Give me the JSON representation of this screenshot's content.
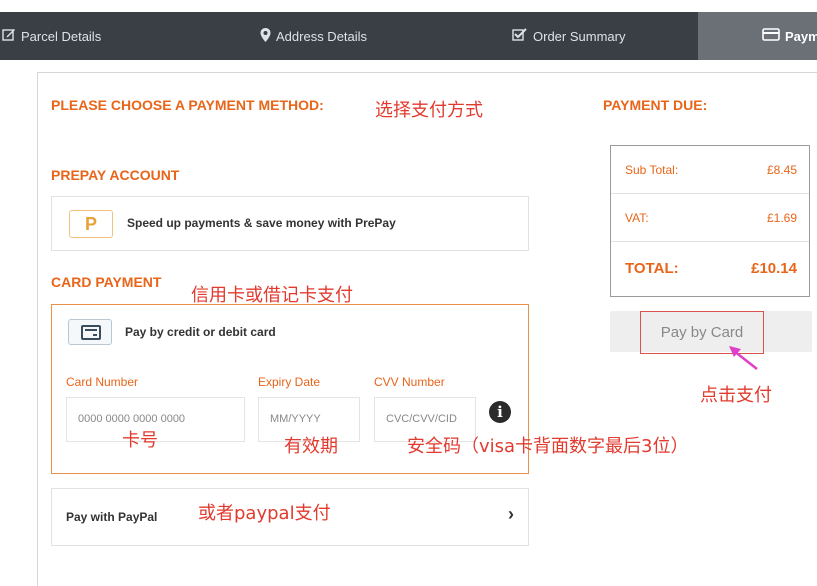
{
  "nav": {
    "steps": [
      {
        "label": "Parcel Details",
        "icon": "edit-icon"
      },
      {
        "label": "Address Details",
        "icon": "map-marker-icon"
      },
      {
        "label": "Order Summary",
        "icon": "checkbox-icon"
      },
      {
        "label": "Payment",
        "icon": "credit-card-icon"
      }
    ]
  },
  "main": {
    "choose_heading": "PLEASE CHOOSE A PAYMENT METHOD:",
    "prepay": {
      "heading": "PREPAY ACCOUNT",
      "icon_glyph": "P",
      "text": "Speed up payments & save money with PrePay"
    },
    "card": {
      "heading": "CARD PAYMENT",
      "title": "Pay by credit or debit card",
      "fields": [
        {
          "label": "Card Number",
          "placeholder": "0000 0000 0000 0000"
        },
        {
          "label": "Expiry Date",
          "placeholder": "MM/YYYY"
        },
        {
          "label": "CVV Number",
          "placeholder": "CVC/CVV/CID"
        }
      ],
      "info_glyph": "i"
    },
    "paypal": {
      "text": "Pay with PayPal",
      "chevron": "›"
    }
  },
  "summary": {
    "heading": "PAYMENT DUE:",
    "rows": [
      {
        "label": "Sub Total:",
        "value": "£8.45"
      },
      {
        "label": "VAT:",
        "value": "£1.69"
      },
      {
        "label": "TOTAL:",
        "value": "£10.14"
      }
    ],
    "button": "Pay by Card"
  },
  "annotations": {
    "choose": "选择支付方式",
    "card": "信用卡或借记卡支付",
    "card_number": "卡号",
    "expiry": "有效期",
    "cvv": "安全码（visa卡背面数字最后3位）",
    "paypal": "或者paypal支付",
    "pay": "点击支付"
  },
  "colors": {
    "accent": "#e8651a",
    "nav_bg": "#3a3f45",
    "nav_active": "#6b7077",
    "annotation": "#e23a2e",
    "arrow": "#e040c8"
  }
}
